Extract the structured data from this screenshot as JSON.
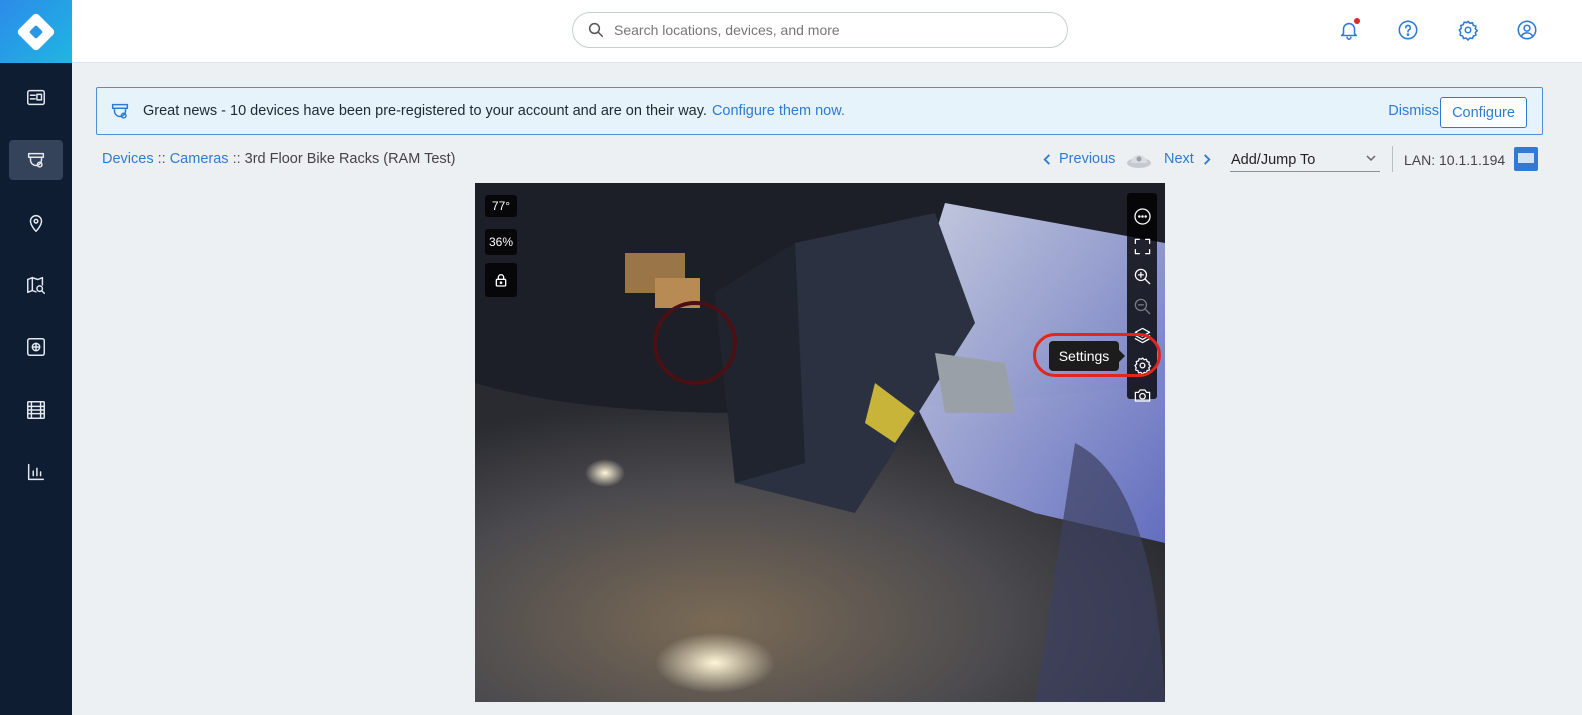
{
  "header": {
    "search_placeholder": "Search locations, devices, and more",
    "icons": [
      "bell-icon",
      "help-icon",
      "gear-icon",
      "user-icon"
    ],
    "notification_dot_color": "#e0262a"
  },
  "sidebar": {
    "active_index": 1,
    "items": [
      "dashboard-icon",
      "devices-icon",
      "location-pin-icon",
      "map-search-icon",
      "photo-frame-icon",
      "film-icon",
      "analytics-icon"
    ]
  },
  "banner": {
    "message": "Great news - 10 devices have been pre-registered to your account and are on their way.",
    "link": "Configure them now.",
    "dismiss": "Dismiss",
    "configure": "Configure"
  },
  "breadcrumb": {
    "devices": "Devices",
    "sep1": "::",
    "cameras": "Cameras",
    "sep2": "::",
    "current": "3rd Floor Bike Racks (RAM Test)"
  },
  "pager": {
    "previous": "Previous",
    "next": "Next"
  },
  "jump": {
    "label": "Add/Jump To"
  },
  "lan": {
    "label": "LAN: 10.1.1.194"
  },
  "video": {
    "temperature": "77°",
    "humidity": "36%",
    "tooltip": "Settings",
    "toolbar": [
      "more-icon",
      "fullscreen-icon",
      "zoom-in-icon",
      "zoom-out-icon",
      "layers-icon",
      "settings-gear-icon",
      "camera-snapshot-icon"
    ]
  },
  "colors": {
    "brand_blue": "#2f7ad4",
    "sidebar_bg": "#0f1d33",
    "banner_bg": "#e6f3fb",
    "highlight": "#e0261d"
  }
}
